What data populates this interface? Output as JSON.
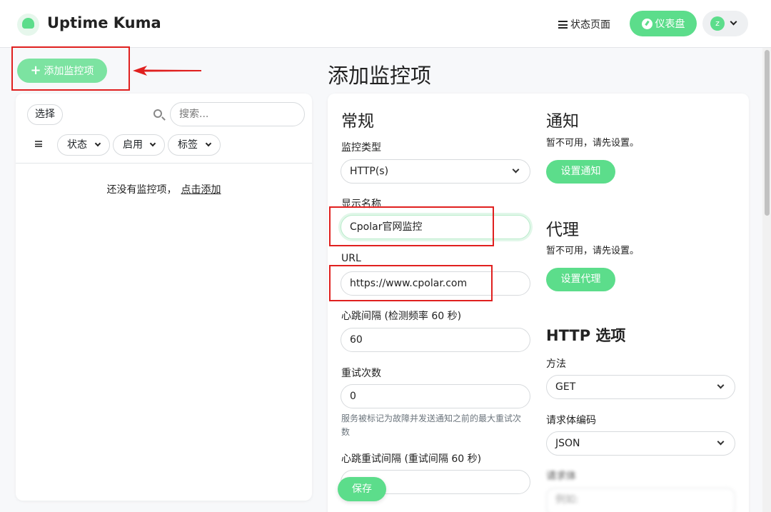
{
  "header": {
    "app_title": "Uptime Kuma",
    "status_page_label": "状态页面",
    "dashboard_label": "仪表盘",
    "avatar_letter": "z"
  },
  "sidebar": {
    "add_label": "添加监控项",
    "select_label": "选择",
    "search_placeholder": "搜索...",
    "filters": [
      "状态",
      "启用",
      "标签"
    ],
    "empty_text": "还没有监控项，",
    "empty_link": "点击添加"
  },
  "form": {
    "page_title": "添加监控项",
    "general_heading": "常规",
    "monitor_type_label": "监控类型",
    "monitor_type_value": "HTTP(s)",
    "friendly_name_label": "显示名称",
    "friendly_name_value": "Cpolar官网监控",
    "url_label": "URL",
    "url_value": "https://www.cpolar.com",
    "interval_label": "心跳间隔 (检测频率 60 秒)",
    "interval_value": "60",
    "retries_label": "重试次数",
    "retries_value": "0",
    "retries_hint": "服务被标记为故障并发送通知之前的最大重试次数",
    "retry_interval_label": "心跳重试间隔 (重试间隔 60 秒)",
    "save_label": "保存"
  },
  "notifications": {
    "heading": "通知",
    "note": "暂不可用，请先设置。",
    "button": "设置通知"
  },
  "proxy": {
    "heading": "代理",
    "note": "暂不可用，请先设置。",
    "button": "设置代理"
  },
  "http_options": {
    "heading": "HTTP 选项",
    "method_label": "方法",
    "method_value": "GET",
    "body_encoding_label": "请求体编码",
    "body_encoding_value": "JSON",
    "body_label": "请求体",
    "body_placeholder": "例如:"
  },
  "colors": {
    "accent": "#5cdd8b",
    "annotation": "#e0201f"
  }
}
